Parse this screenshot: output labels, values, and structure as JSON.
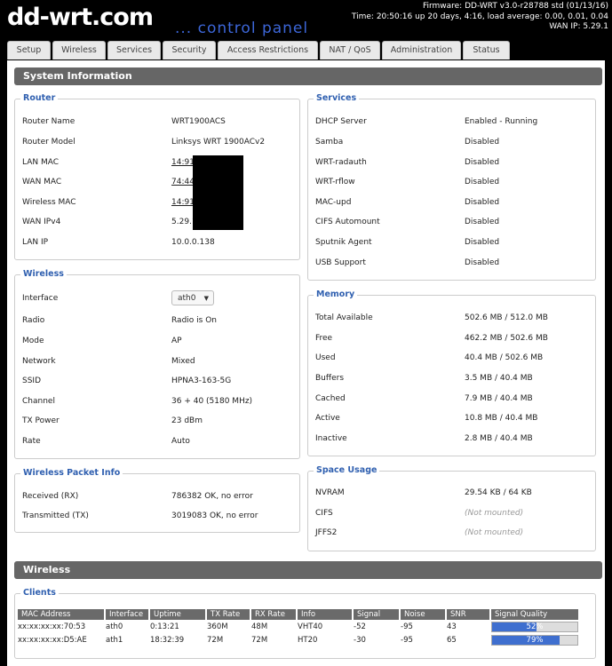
{
  "header": {
    "logo": "dd-wrt.com",
    "logo_suffix": "... control panel",
    "firmware": "Firmware: DD-WRT v3.0-r28788 std (01/13/16)",
    "time": "Time: 20:50:16 up 20 days, 4:16, load average: 0.00, 0.01, 0.04",
    "wan_ip": "WAN IP: 5.29.1"
  },
  "tabs": [
    "Setup",
    "Wireless",
    "Services",
    "Security",
    "Access Restrictions",
    "NAT / QoS",
    "Administration",
    "Status"
  ],
  "system_info": {
    "title": "System Information",
    "router": {
      "legend": "Router",
      "rows": [
        {
          "label": "Router Name",
          "value": "WRT1900ACS"
        },
        {
          "label": "Router Model",
          "value": "Linksys WRT 1900ACv2"
        },
        {
          "label": "LAN MAC",
          "value": "14:91:"
        },
        {
          "label": "WAN MAC",
          "value": "74:44:"
        },
        {
          "label": "Wireless MAC",
          "value": "14:91:"
        },
        {
          "label": "WAN IPv4",
          "value": "5.29.1"
        },
        {
          "label": "LAN IP",
          "value": "10.0.0.138"
        }
      ]
    },
    "services": {
      "legend": "Services",
      "rows": [
        {
          "label": "DHCP Server",
          "value": "Enabled - Running"
        },
        {
          "label": "Samba",
          "value": "Disabled"
        },
        {
          "label": "WRT-radauth",
          "value": "Disabled"
        },
        {
          "label": "WRT-rflow",
          "value": "Disabled"
        },
        {
          "label": "MAC-upd",
          "value": "Disabled"
        },
        {
          "label": "CIFS Automount",
          "value": "Disabled"
        },
        {
          "label": "Sputnik Agent",
          "value": "Disabled"
        },
        {
          "label": "USB Support",
          "value": "Disabled"
        }
      ]
    },
    "wireless": {
      "legend": "Wireless",
      "interface_label": "Interface",
      "interface_value": "ath0",
      "rows": [
        {
          "label": "Radio",
          "value": "Radio is On"
        },
        {
          "label": "Mode",
          "value": "AP"
        },
        {
          "label": "Network",
          "value": "Mixed"
        },
        {
          "label": "SSID",
          "value": "HPNA3-163-5G"
        },
        {
          "label": "Channel",
          "value": "36 + 40 (5180 MHz)"
        },
        {
          "label": "TX Power",
          "value": "23 dBm"
        },
        {
          "label": "Rate",
          "value": "Auto"
        }
      ]
    },
    "memory": {
      "legend": "Memory",
      "rows": [
        {
          "label": "Total Available",
          "value": "502.6 MB / 512.0 MB"
        },
        {
          "label": "Free",
          "value": "462.2 MB / 502.6 MB"
        },
        {
          "label": "Used",
          "value": "40.4 MB / 502.6 MB"
        },
        {
          "label": "Buffers",
          "value": "3.5 MB / 40.4 MB"
        },
        {
          "label": "Cached",
          "value": "7.9 MB / 40.4 MB"
        },
        {
          "label": "Active",
          "value": "10.8 MB / 40.4 MB"
        },
        {
          "label": "Inactive",
          "value": "2.8 MB / 40.4 MB"
        }
      ]
    },
    "packet_info": {
      "legend": "Wireless Packet Info",
      "rows": [
        {
          "label": "Received (RX)",
          "value": "786382 OK, no error"
        },
        {
          "label": "Transmitted (TX)",
          "value": "3019083 OK, no error"
        }
      ]
    },
    "space_usage": {
      "legend": "Space Usage",
      "rows": [
        {
          "label": "NVRAM",
          "value": "29.54 KB / 64 KB"
        },
        {
          "label": "CIFS",
          "value": "(Not mounted)"
        },
        {
          "label": "JFFS2",
          "value": "(Not mounted)"
        }
      ]
    }
  },
  "wireless_section": {
    "title": "Wireless",
    "clients_legend": "Clients",
    "columns": [
      "MAC Address",
      "Interface",
      "Uptime",
      "TX Rate",
      "RX Rate",
      "Info",
      "Signal",
      "Noise",
      "SNR",
      "Signal Quality"
    ],
    "rows": [
      {
        "mac": "xx:xx:xx:xx:70:53",
        "iface": "ath0",
        "uptime": "0:13:21",
        "tx": "360M",
        "rx": "48M",
        "info": "VHT40",
        "signal": "-52",
        "noise": "-95",
        "snr": "43",
        "quality": "52%",
        "quality_fraction": 0.52
      },
      {
        "mac": "xx:xx:xx:xx:D5:AE",
        "iface": "ath1",
        "uptime": "18:32:39",
        "tx": "72M",
        "rx": "72M",
        "info": "HT20",
        "signal": "-30",
        "noise": "-95",
        "snr": "65",
        "quality": "79%",
        "quality_fraction": 0.79
      }
    ]
  },
  "colors": {
    "accent_blue": "#3060b0",
    "bar_gray": "#666666",
    "quality_fill": "#3f6fcf"
  }
}
